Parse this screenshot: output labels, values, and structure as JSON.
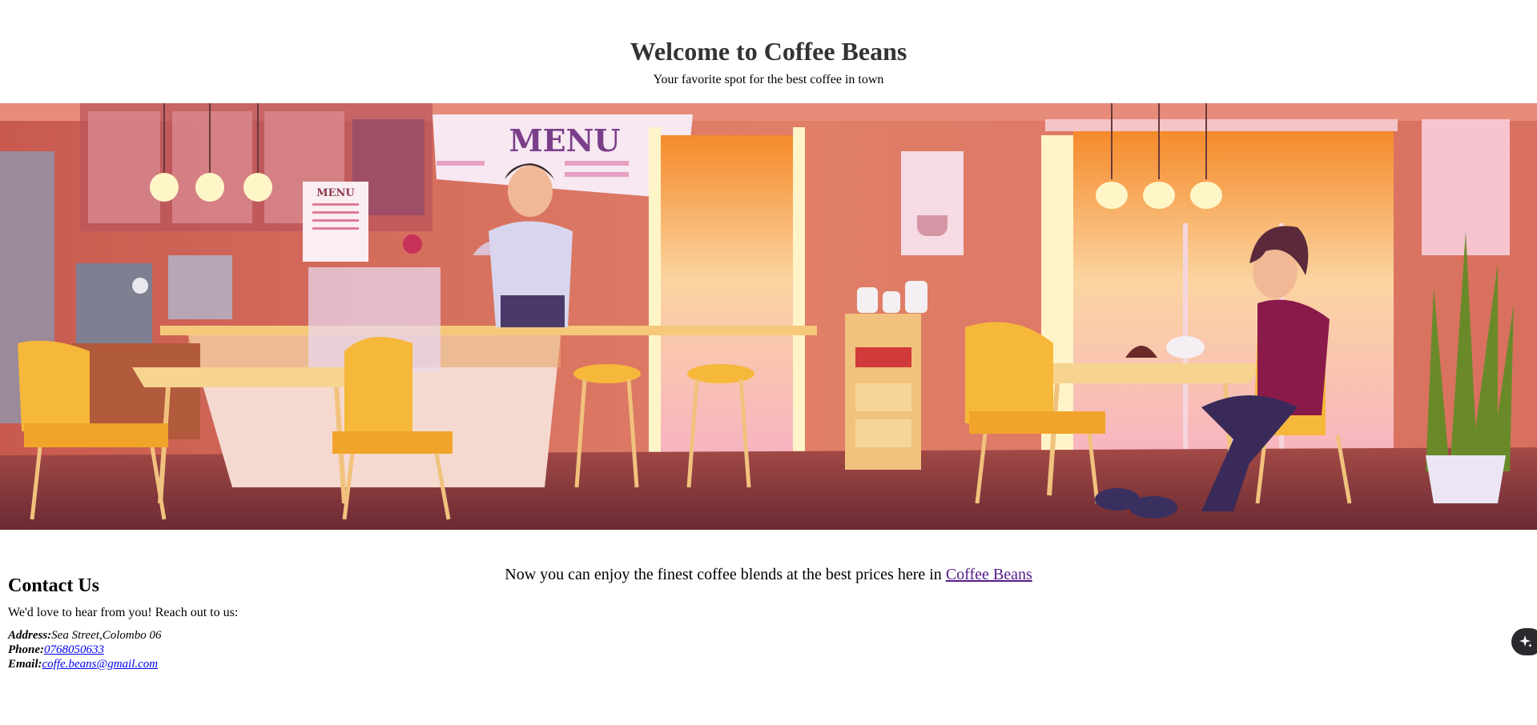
{
  "header": {
    "title": "Welcome to Coffee Beans",
    "tagline": "Your favorite spot for the best coffee in town"
  },
  "hero": {
    "menu_board_text": "MENU",
    "menu_card_text": "MENU"
  },
  "intro": {
    "text": "Now you can enjoy the finest coffee blends at the best prices here in ",
    "link_label": "Coffee Beans"
  },
  "contact": {
    "heading": "Contact Us",
    "lead": "We'd love to hear from you! Reach out to us:",
    "address_label": "Address:",
    "address_value": "Sea Street,Colombo 06",
    "phone_label": "Phone:",
    "phone_value": "0768050633",
    "email_label": "Email:",
    "email_value": "coffe.beans@gmail.com"
  },
  "floating_button": {
    "icon": "sparkle-icon"
  },
  "colors": {
    "title": "#333333",
    "visited_link": "#551a8b",
    "link": "#0000ee",
    "hero_wall": "#d9705f",
    "hero_floor": "#8c3a3a",
    "chair": "#f6b83a"
  }
}
